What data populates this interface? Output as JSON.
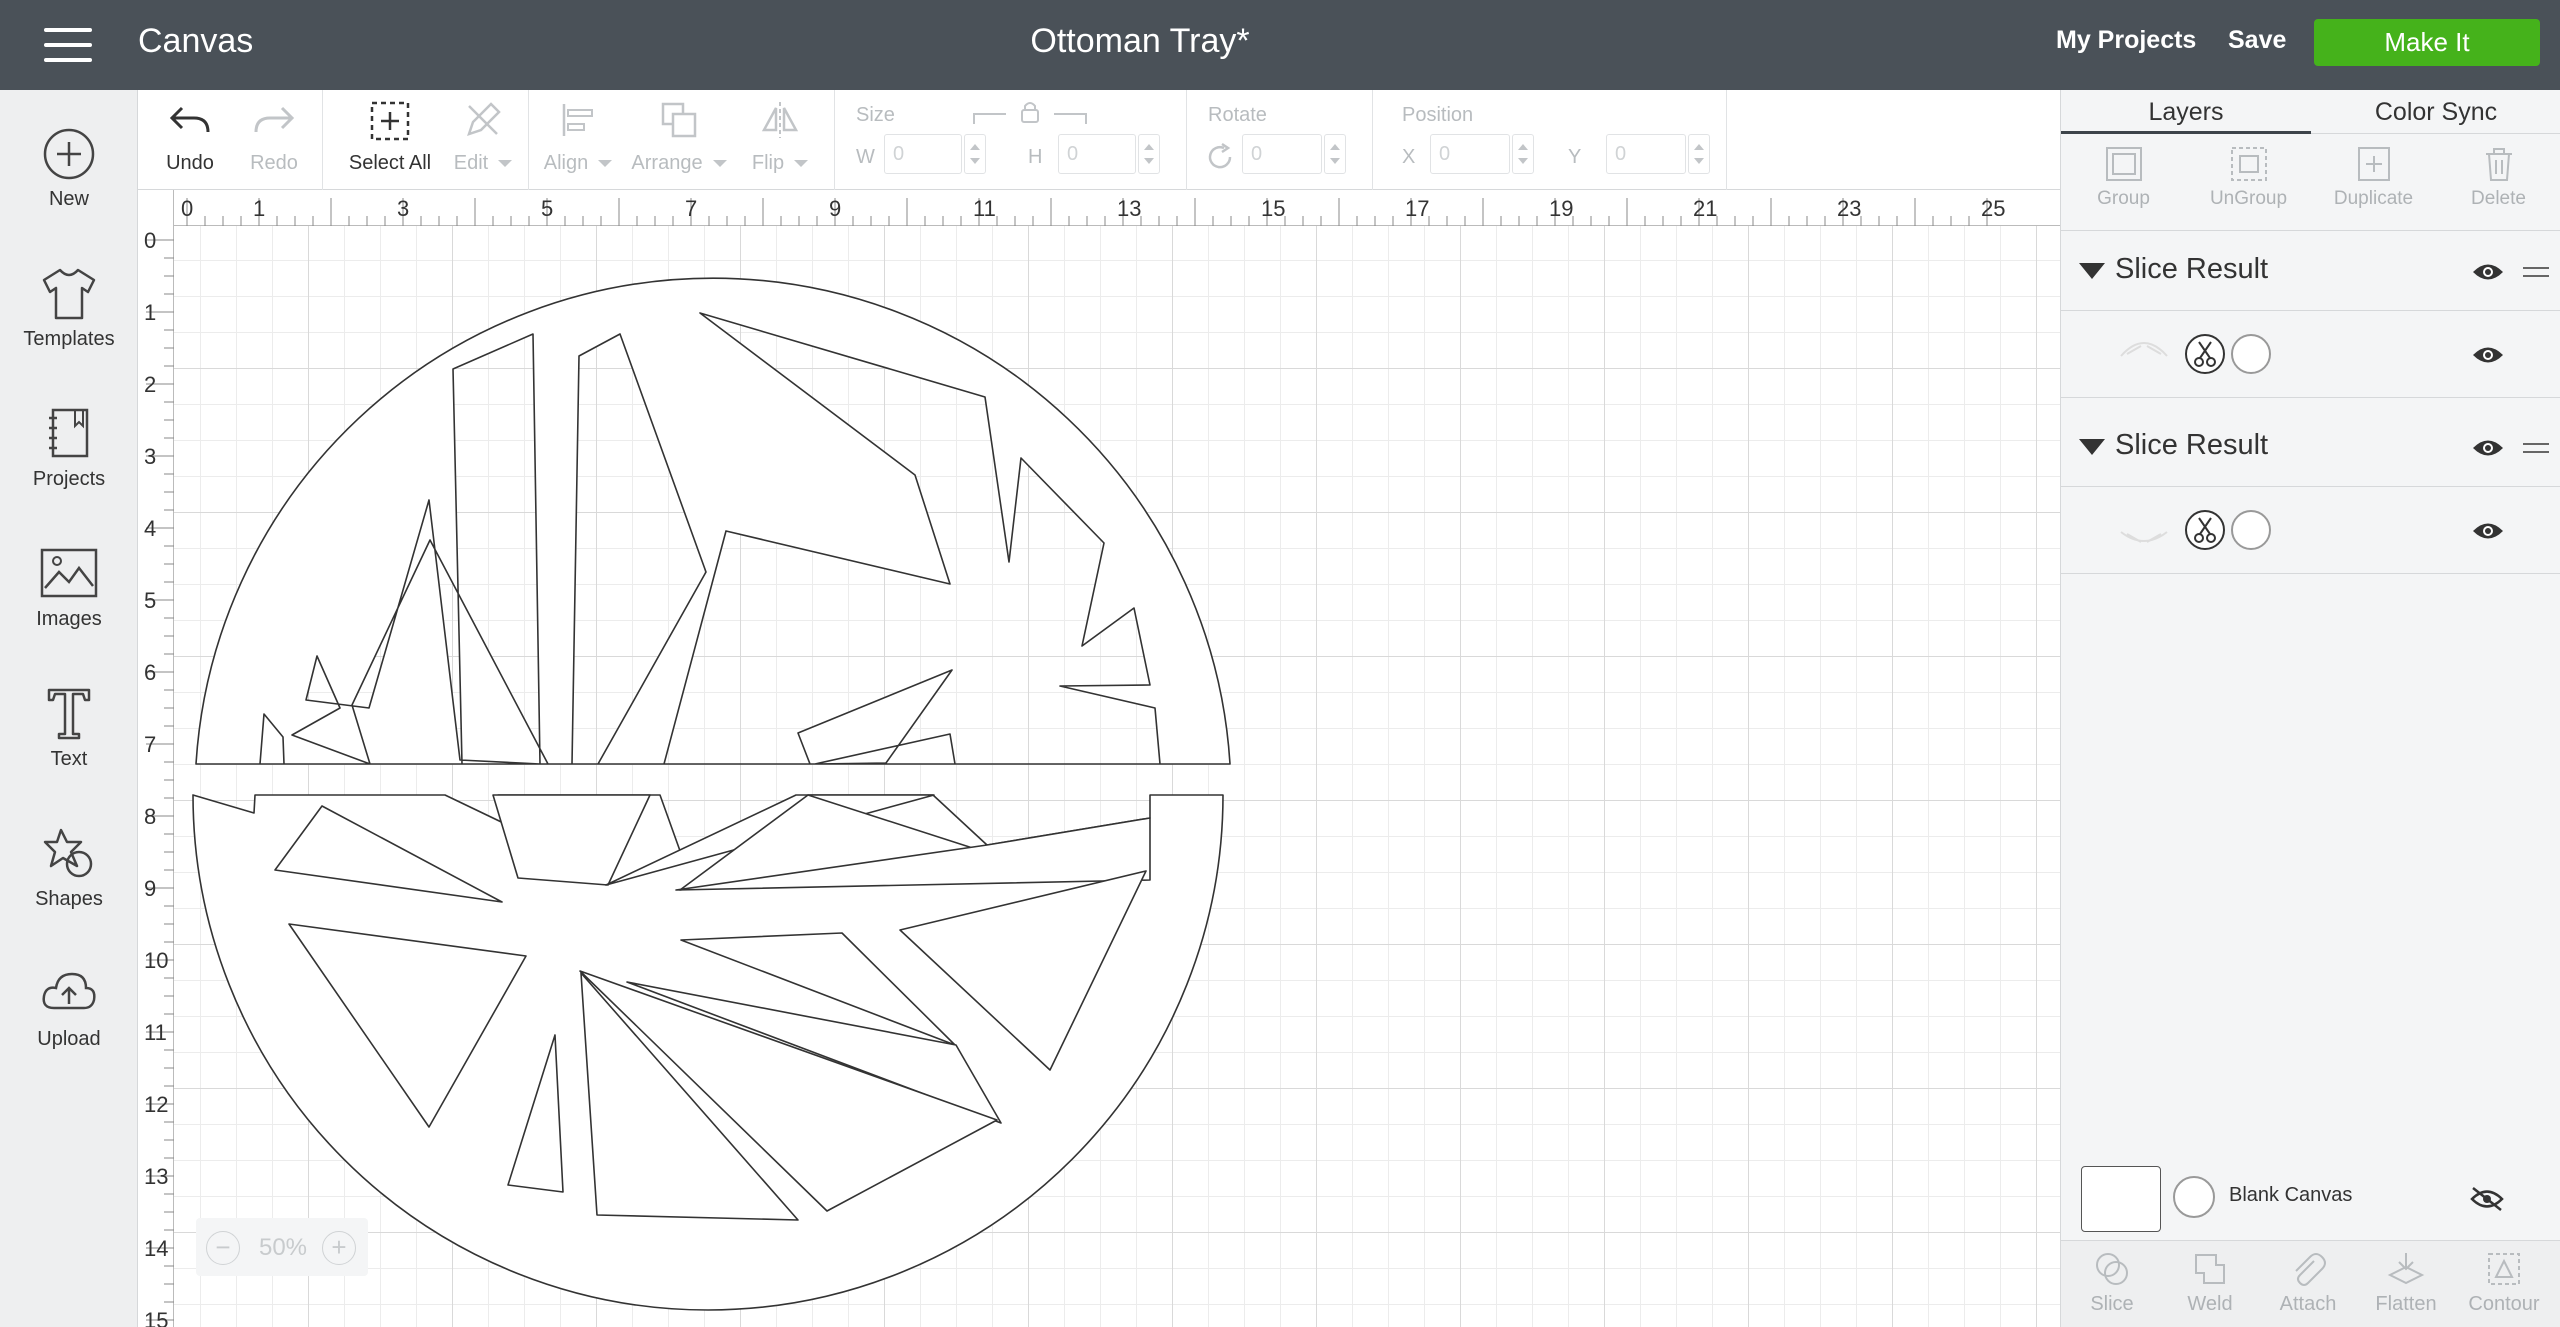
{
  "header": {
    "app_title": "Canvas",
    "document_title": "Ottoman Tray*",
    "my_projects": "My Projects",
    "save": "Save",
    "make_it": "Make It"
  },
  "sidebar": {
    "items": [
      {
        "label": "New",
        "icon": "plus-circle-icon"
      },
      {
        "label": "Templates",
        "icon": "tshirt-icon"
      },
      {
        "label": "Projects",
        "icon": "notebook-icon"
      },
      {
        "label": "Images",
        "icon": "image-icon"
      },
      {
        "label": "Text",
        "icon": "text-t-icon"
      },
      {
        "label": "Shapes",
        "icon": "shapes-icon"
      },
      {
        "label": "Upload",
        "icon": "cloud-upload-icon"
      }
    ]
  },
  "toolbar": {
    "undo": "Undo",
    "redo": "Redo",
    "select_all": "Select All",
    "edit": "Edit",
    "align": "Align",
    "arrange": "Arrange",
    "flip": "Flip",
    "size_label": "Size",
    "w_label": "W",
    "w_value": "0",
    "h_label": "H",
    "h_value": "0",
    "rotate_label": "Rotate",
    "rotate_value": "0",
    "position_label": "Position",
    "x_label": "X",
    "x_value": "0",
    "y_label": "Y",
    "y_value": "0"
  },
  "rulers": {
    "horizontal": [
      "0",
      "1",
      "3",
      "5",
      "7",
      "9",
      "11",
      "13",
      "15",
      "17",
      "19",
      "21",
      "23",
      "25"
    ],
    "vertical": [
      "0",
      "1",
      "2",
      "3",
      "4",
      "5",
      "6",
      "7",
      "8",
      "9",
      "10",
      "11",
      "12",
      "13",
      "14",
      "15"
    ]
  },
  "zoom": {
    "minus": "−",
    "value": "50%",
    "plus": "+"
  },
  "panel": {
    "tabs": [
      "Layers",
      "Color Sync"
    ],
    "tools": [
      "Group",
      "UnGroup",
      "Duplicate",
      "Delete"
    ],
    "layers": [
      {
        "name": "Slice Result"
      },
      {
        "name": "Slice Result"
      }
    ],
    "blank_canvas": "Blank Canvas",
    "bottom_tools": [
      "Slice",
      "Weld",
      "Attach",
      "Flatten",
      "Contour"
    ]
  },
  "colors": {
    "topbar": "#4a5158",
    "make_it": "#45b21b",
    "panel_bg": "#f4f5f6"
  }
}
